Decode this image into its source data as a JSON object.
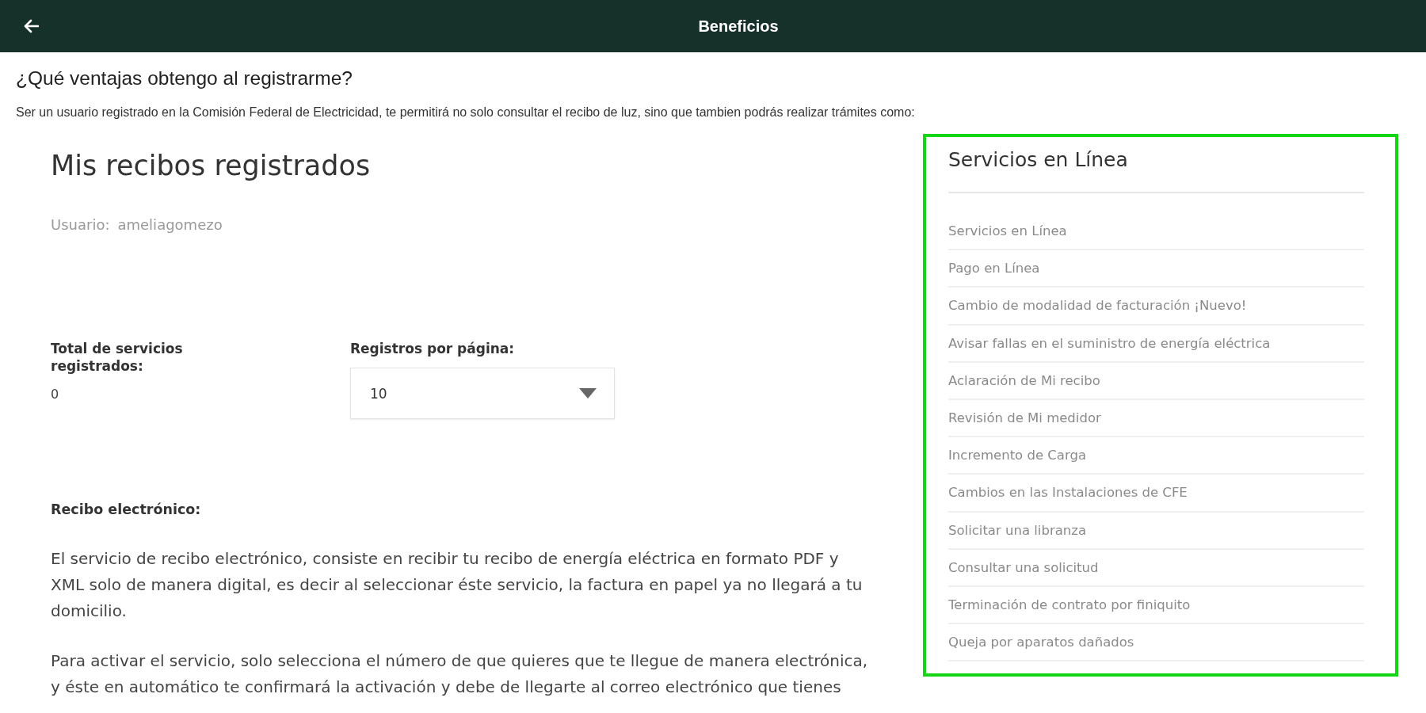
{
  "header": {
    "title": "Beneficios"
  },
  "intro": {
    "question": "¿Qué ventajas obtengo al registrarme?",
    "description": "Ser un usuario registrado en la Comisión Federal de Electricidad, te permitirá no solo consultar el recibo de luz, sino que tambien podrás realizar trámites como:"
  },
  "receipts": {
    "title": "Mis recibos registrados",
    "user_label": "Usuario:",
    "user_value": "ameliagomezo",
    "total_label": "Total de servicios registrados:",
    "total_value": "0",
    "per_page_label": "Registros por página:",
    "per_page_value": "10"
  },
  "electronic_receipt": {
    "heading": "Recibo electrónico:",
    "paragraphs": [
      "El servicio de recibo electrónico, consiste en recibir tu recibo de energía eléctrica en formato PDF y XML solo de manera digital, es decir al seleccionar éste servicio, la factura en papel ya no llegará a tu domicilio.",
      "Para activar el servicio, solo selecciona el número de que quieres que te llegue de manera electrónica, y éste en automático te confirmará la activación y debe de llegarte al correo electrónico que tienes"
    ]
  },
  "online_services": {
    "title": "Servicios en Línea",
    "items": [
      "Servicios en Línea",
      "Pago en Línea",
      "Cambio de modalidad de facturación ¡Nuevo!",
      "Avisar fallas en el suministro de energía eléctrica",
      "Aclaración de Mi recibo",
      "Revisión de Mi medidor",
      "Incremento de Carga",
      "Cambios en las Instalaciones de CFE",
      "Solicitar una libranza",
      "Consultar una solicitud",
      "Terminación de contrato por finiquito",
      "Queja por aparatos dañados"
    ]
  }
}
